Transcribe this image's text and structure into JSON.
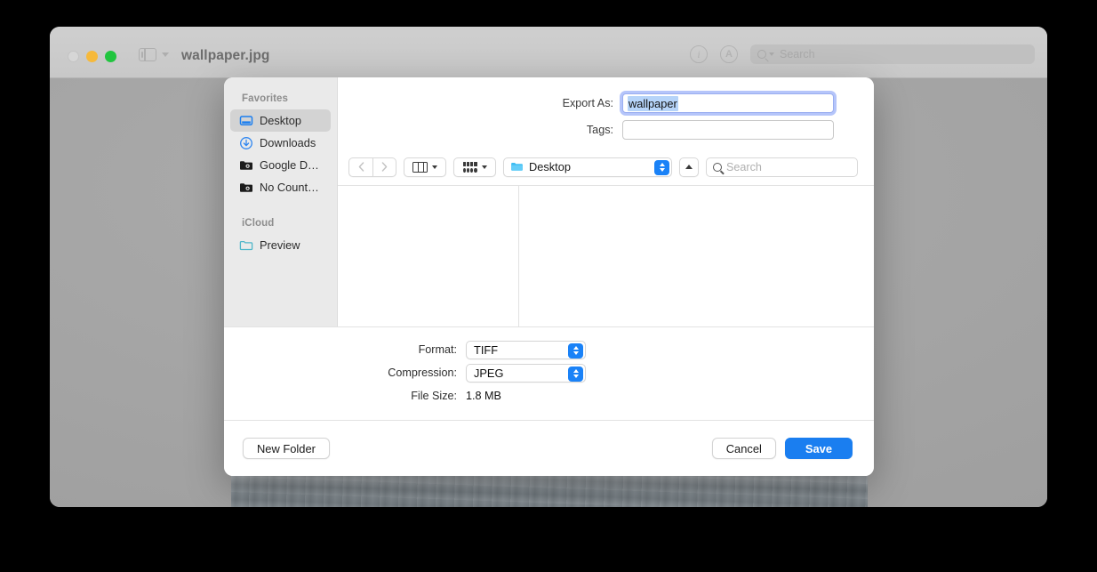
{
  "window": {
    "title": "wallpaper.jpg",
    "traffic_lights": [
      "close",
      "minimize",
      "maximize"
    ],
    "sidebar_toggle_icon": "sidebar-toggle-icon",
    "info_icon": "info-icon",
    "markup_icon": "markup-icon",
    "search_placeholder": "Search"
  },
  "sheet": {
    "sidebar": {
      "sections": [
        {
          "header": "Favorites",
          "items": [
            {
              "label": "Desktop",
              "icon": "desktop-icon",
              "selected": true
            },
            {
              "label": "Downloads",
              "icon": "downloads-icon",
              "selected": false
            },
            {
              "label": "Google D…",
              "icon": "folder-alias-icon",
              "selected": false
            },
            {
              "label": "No Count…",
              "icon": "folder-alias-icon",
              "selected": false
            }
          ]
        },
        {
          "header": "iCloud",
          "items": [
            {
              "label": "Preview",
              "icon": "folder-icon",
              "selected": false
            }
          ]
        }
      ]
    },
    "form": {
      "export_as_label": "Export As:",
      "export_as_value": "wallpaper",
      "tags_label": "Tags:",
      "tags_value": "",
      "tags_placeholder": ""
    },
    "navbar": {
      "back_icon": "chevron-left-icon",
      "forward_icon": "chevron-right-icon",
      "view_icon": "column-view-icon",
      "group_icon": "group-by-icon",
      "path_label": "Desktop",
      "path_folder_icon": "folder-icon",
      "stepper_icon": "up-down-stepper-icon",
      "collapse_icon": "chevron-up-icon",
      "search_placeholder": "Search"
    },
    "options": [
      {
        "label": "Format:",
        "value": "TIFF",
        "type": "popup"
      },
      {
        "label": "Compression:",
        "value": "JPEG",
        "type": "popup"
      },
      {
        "label": "File Size:",
        "value": "1.8 MB",
        "type": "static"
      }
    ],
    "buttons": {
      "new_folder": "New Folder",
      "cancel": "Cancel",
      "save": "Save"
    }
  },
  "colors": {
    "accent_blue": "#1a7ef0",
    "stepper_blue": "#1a82f7",
    "selection_blue": "#b6d4f9",
    "sidebar_bg": "#eaeaea",
    "titlebar_bg": "#c8c8c8"
  }
}
